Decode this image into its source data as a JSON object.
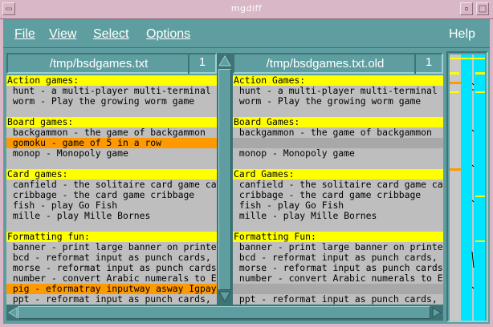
{
  "window": {
    "title": "mgdiff"
  },
  "menu": [
    {
      "label": "File"
    },
    {
      "label": "View"
    },
    {
      "label": "Select"
    },
    {
      "label": "Options"
    },
    {
      "label": "Help"
    }
  ],
  "left": {
    "filename": "/tmp/bsdgames.txt",
    "line": "1",
    "rows": [
      {
        "type": "hdr",
        "text": "Action games:"
      },
      {
        "type": "n",
        "text": " hunt - a multi-player multi-terminal game"
      },
      {
        "type": "n",
        "text": " worm - Play the growing worm game"
      },
      {
        "type": "gap",
        "text": ""
      },
      {
        "type": "hdr",
        "text": "Board games:"
      },
      {
        "type": "n",
        "text": " backgammon - the game of backgammon"
      },
      {
        "type": "ins",
        "text": " gomoku - game of 5 in a row"
      },
      {
        "type": "n",
        "text": " monop - Monopoly game"
      },
      {
        "type": "gap",
        "text": ""
      },
      {
        "type": "hdr",
        "text": "Card games:"
      },
      {
        "type": "n",
        "text": " canfield - the solitaire card game canfield"
      },
      {
        "type": "n",
        "text": " cribbage - the card game cribbage"
      },
      {
        "type": "n",
        "text": " fish - play Go Fish"
      },
      {
        "type": "n",
        "text": " mille - play Mille Bornes"
      },
      {
        "type": "gap",
        "text": ""
      },
      {
        "type": "hdr",
        "text": "Formatting fun:"
      },
      {
        "type": "n",
        "text": " banner - print large banner on printer"
      },
      {
        "type": "n",
        "text": " bcd - reformat input as punch cards, paper tape"
      },
      {
        "type": "n",
        "text": " morse - reformat input as punch cards"
      },
      {
        "type": "n",
        "text": " number - convert Arabic numerals to English"
      },
      {
        "type": "ins",
        "text": " pig - eformatray inputway asway Igpay Atinlay"
      },
      {
        "type": "n",
        "text": " ppt - reformat input as punch cards, paper tape"
      }
    ]
  },
  "right": {
    "filename": "/tmp/bsdgames.txt.old",
    "line": "1",
    "rows": [
      {
        "type": "hdr",
        "text": "Action Games:"
      },
      {
        "type": "n",
        "text": " hunt - a multi-player multi-terminal game"
      },
      {
        "type": "n",
        "text": " worm - Play the growing worm game"
      },
      {
        "type": "gap",
        "text": ""
      },
      {
        "type": "hdr",
        "text": "Board Games:"
      },
      {
        "type": "n",
        "text": " backgammon - the game of backgammon"
      },
      {
        "type": "blank",
        "text": ""
      },
      {
        "type": "n",
        "text": " monop - Monopoly game"
      },
      {
        "type": "gap",
        "text": ""
      },
      {
        "type": "hdr",
        "text": "Card Games:"
      },
      {
        "type": "n",
        "text": " canfield - the solitaire card game canfield"
      },
      {
        "type": "n",
        "text": " cribbage - the card game cribbage"
      },
      {
        "type": "n",
        "text": " fish - play Go Fish"
      },
      {
        "type": "n",
        "text": " mille - play Mille Bornes"
      },
      {
        "type": "gap",
        "text": ""
      },
      {
        "type": "hdr",
        "text": "Formatting Fun:"
      },
      {
        "type": "n",
        "text": " banner - print large banner on printer"
      },
      {
        "type": "n",
        "text": " bcd - reformat input as punch cards, paper tape"
      },
      {
        "type": "n",
        "text": " morse - reformat input as punch cards"
      },
      {
        "type": "n",
        "text": " number - convert Arabic numerals to English"
      },
      {
        "type": "blank",
        "text": ""
      },
      {
        "type": "n",
        "text": " ppt - reformat input as punch cards, paper tape"
      }
    ]
  },
  "colors": {
    "header": "#ffff00",
    "inserted": "#ff9900",
    "blank": "#a8a8a8",
    "overview_column": "#00e5ff"
  },
  "icons": {
    "window_menu": "window-menu-icon",
    "minimize": "minimize-icon",
    "maximize": "maximize-icon",
    "scroll_up": "arrow-up-icon",
    "scroll_down": "arrow-down-icon",
    "scroll_left": "arrow-left-icon",
    "scroll_right": "arrow-right-icon"
  }
}
